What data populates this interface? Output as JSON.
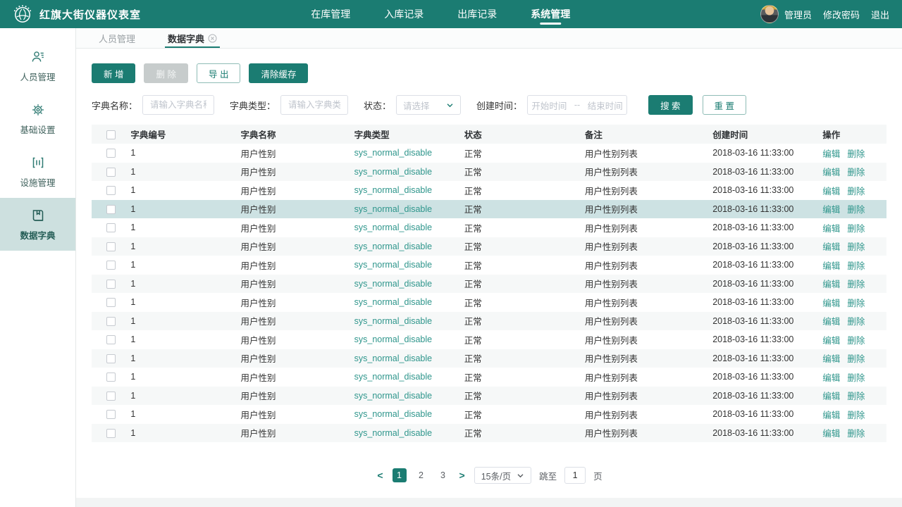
{
  "colors": {
    "primary": "#1b7c72",
    "link": "#2f968c",
    "row_highlight": "#cde2e3",
    "row_stripe": "#f6f8f8"
  },
  "navbar": {
    "title": "红旗大街仪器仪表室",
    "items": [
      {
        "label": "在库管理",
        "active": false
      },
      {
        "label": "入库记录",
        "active": false
      },
      {
        "label": "出库记录",
        "active": false
      },
      {
        "label": "系统管理",
        "active": true
      }
    ],
    "user": "管理员",
    "change_password": "修改密码",
    "logout": "退出"
  },
  "sidebar": {
    "items": [
      {
        "label": "人员管理",
        "icon": "person-icon",
        "active": false
      },
      {
        "label": "基础设置",
        "icon": "gear-icon",
        "active": false
      },
      {
        "label": "设施管理",
        "icon": "facility-icon",
        "active": false
      },
      {
        "label": "数据字典",
        "icon": "book-icon",
        "active": true
      }
    ]
  },
  "tabs": [
    {
      "label": "人员管理",
      "active": false
    },
    {
      "label": "数据字典",
      "active": true,
      "closable": true
    }
  ],
  "toolbar": {
    "add": "新 增",
    "delete": "删 除",
    "export": "导 出",
    "clear_cache": "清除缓存"
  },
  "filters": {
    "dict_name_label": "字典名称：",
    "dict_name_placeholder": "请输入字典名称",
    "dict_type_label": "字典类型：",
    "dict_type_placeholder": "请输入字典类型",
    "status_label": "状态：",
    "status_placeholder": "请选择",
    "create_time_label": "创建时间：",
    "start_placeholder": "开始时间",
    "range_separator": "--",
    "end_placeholder": "结束时间",
    "search": "搜 索",
    "reset": "重 置"
  },
  "table": {
    "headers": [
      "字典编号",
      "字典名称",
      "字典类型",
      "状态",
      "备注",
      "创建时间",
      "操作"
    ],
    "edit_label": "编辑",
    "delete_label": "删除",
    "rows": [
      {
        "id": "1",
        "name": "用户性别",
        "type": "sys_normal_disable",
        "status": "正常",
        "remark": "用户性别列表",
        "created": "2018-03-16 11:33:00"
      },
      {
        "id": "1",
        "name": "用户性别",
        "type": "sys_normal_disable",
        "status": "正常",
        "remark": "用户性别列表",
        "created": "2018-03-16 11:33:00"
      },
      {
        "id": "1",
        "name": "用户性别",
        "type": "sys_normal_disable",
        "status": "正常",
        "remark": "用户性别列表",
        "created": "2018-03-16 11:33:00"
      },
      {
        "id": "1",
        "name": "用户性别",
        "type": "sys_normal_disable",
        "status": "正常",
        "remark": "用户性别列表",
        "created": "2018-03-16 11:33:00",
        "highlighted": true
      },
      {
        "id": "1",
        "name": "用户性别",
        "type": "sys_normal_disable",
        "status": "正常",
        "remark": "用户性别列表",
        "created": "2018-03-16 11:33:00"
      },
      {
        "id": "1",
        "name": "用户性别",
        "type": "sys_normal_disable",
        "status": "正常",
        "remark": "用户性别列表",
        "created": "2018-03-16 11:33:00"
      },
      {
        "id": "1",
        "name": "用户性别",
        "type": "sys_normal_disable",
        "status": "正常",
        "remark": "用户性别列表",
        "created": "2018-03-16 11:33:00"
      },
      {
        "id": "1",
        "name": "用户性别",
        "type": "sys_normal_disable",
        "status": "正常",
        "remark": "用户性别列表",
        "created": "2018-03-16 11:33:00"
      },
      {
        "id": "1",
        "name": "用户性别",
        "type": "sys_normal_disable",
        "status": "正常",
        "remark": "用户性别列表",
        "created": "2018-03-16 11:33:00"
      },
      {
        "id": "1",
        "name": "用户性别",
        "type": "sys_normal_disable",
        "status": "正常",
        "remark": "用户性别列表",
        "created": "2018-03-16 11:33:00"
      },
      {
        "id": "1",
        "name": "用户性别",
        "type": "sys_normal_disable",
        "status": "正常",
        "remark": "用户性别列表",
        "created": "2018-03-16 11:33:00"
      },
      {
        "id": "1",
        "name": "用户性别",
        "type": "sys_normal_disable",
        "status": "正常",
        "remark": "用户性别列表",
        "created": "2018-03-16 11:33:00"
      },
      {
        "id": "1",
        "name": "用户性别",
        "type": "sys_normal_disable",
        "status": "正常",
        "remark": "用户性别列表",
        "created": "2018-03-16 11:33:00"
      },
      {
        "id": "1",
        "name": "用户性别",
        "type": "sys_normal_disable",
        "status": "正常",
        "remark": "用户性别列表",
        "created": "2018-03-16 11:33:00"
      },
      {
        "id": "1",
        "name": "用户性别",
        "type": "sys_normal_disable",
        "status": "正常",
        "remark": "用户性别列表",
        "created": "2018-03-16 11:33:00"
      },
      {
        "id": "1",
        "name": "用户性别",
        "type": "sys_normal_disable",
        "status": "正常",
        "remark": "用户性别列表",
        "created": "2018-03-16 11:33:00"
      }
    ]
  },
  "pagination": {
    "pages": [
      "1",
      "2",
      "3"
    ],
    "active_page": "1",
    "page_size": "15条/页",
    "jump_label": "跳至",
    "jump_value": "1",
    "page_unit": "页"
  }
}
